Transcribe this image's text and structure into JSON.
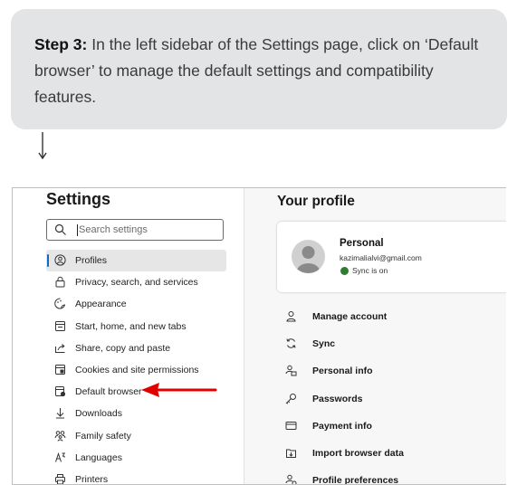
{
  "callout": {
    "step": "Step 3:",
    "text": " In the left sidebar of the Settings page, click on ‘Default browser’ to manage the default settings and compatibility features."
  },
  "settings": {
    "title": "Settings",
    "search_placeholder": "Search settings",
    "nav": [
      {
        "label": "Profiles",
        "icon": "profile-icon",
        "active": true
      },
      {
        "label": "Privacy, search, and services",
        "icon": "lock-icon"
      },
      {
        "label": "Appearance",
        "icon": "appearance-icon"
      },
      {
        "label": "Start, home, and new tabs",
        "icon": "home-tabs-icon"
      },
      {
        "label": "Share, copy and paste",
        "icon": "share-icon"
      },
      {
        "label": "Cookies and site permissions",
        "icon": "cookies-icon"
      },
      {
        "label": "Default browser",
        "icon": "browser-icon"
      },
      {
        "label": "Downloads",
        "icon": "download-icon"
      },
      {
        "label": "Family safety",
        "icon": "family-icon"
      },
      {
        "label": "Languages",
        "icon": "languages-icon"
      },
      {
        "label": "Printers",
        "icon": "printer-icon"
      }
    ]
  },
  "profile": {
    "title": "Your profile",
    "name": "Personal",
    "email": "kazimalialvi@gmail.com",
    "sync_status": "Sync is on",
    "menu": [
      {
        "label": "Manage account",
        "icon": "person-icon"
      },
      {
        "label": "Sync",
        "icon": "sync-icon"
      },
      {
        "label": "Personal info",
        "icon": "personal-info-icon"
      },
      {
        "label": "Passwords",
        "icon": "key-icon"
      },
      {
        "label": "Payment info",
        "icon": "card-icon"
      },
      {
        "label": "Import browser data",
        "icon": "import-icon"
      },
      {
        "label": "Profile preferences",
        "icon": "preferences-icon"
      }
    ]
  },
  "colors": {
    "accent": "#0f6cbd",
    "annotation_arrow": "#e00000",
    "sync_green": "#2e7d32"
  }
}
